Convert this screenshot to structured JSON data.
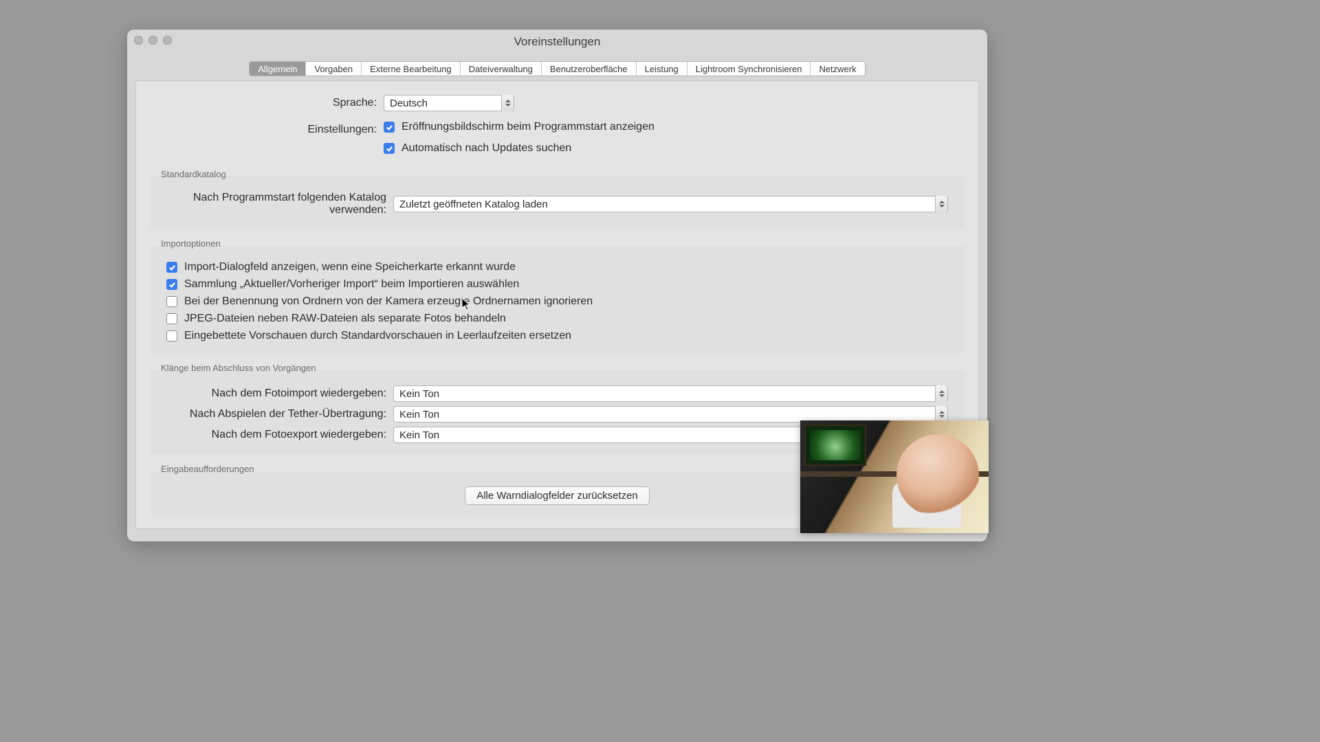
{
  "window": {
    "title": "Voreinstellungen"
  },
  "tabs": [
    {
      "id": "allgemein",
      "label": "Allgemein",
      "active": true
    },
    {
      "id": "vorgaben",
      "label": "Vorgaben"
    },
    {
      "id": "extern",
      "label": "Externe Bearbeitung"
    },
    {
      "id": "datei",
      "label": "Dateiverwaltung"
    },
    {
      "id": "ui",
      "label": "Benutzeroberfläche"
    },
    {
      "id": "leistung",
      "label": "Leistung"
    },
    {
      "id": "sync",
      "label": "Lightroom Synchronisieren"
    },
    {
      "id": "netz",
      "label": "Netzwerk"
    }
  ],
  "language": {
    "label": "Sprache:",
    "value": "Deutsch"
  },
  "settings": {
    "label": "Einstellungen:",
    "opt1": "Eröffnungsbildschirm beim Programmstart anzeigen",
    "opt2": "Automatisch nach Updates suchen"
  },
  "catalog": {
    "legend": "Standardkatalog",
    "label": "Nach Programmstart folgenden Katalog verwenden:",
    "value": "Zuletzt geöffneten Katalog laden"
  },
  "import": {
    "legend": "Importoptionen",
    "o1": "Import-Dialogfeld anzeigen, wenn eine Speicherkarte erkannt wurde",
    "o2": "Sammlung „Aktueller/Vorheriger Import“ beim Importieren auswählen",
    "o3": "Bei der Benennung von Ordnern von der Kamera erzeugte Ordnernamen ignorieren",
    "o4": "JPEG-Dateien neben RAW-Dateien als separate Fotos behandeln",
    "o5": "Eingebettete Vorschauen durch Standardvorschauen in Leerlaufzeiten ersetzen"
  },
  "sounds": {
    "legend": "Klänge beim Abschluss von Vorgängen",
    "r1": {
      "label": "Nach dem Fotoimport wiedergeben:",
      "value": "Kein Ton"
    },
    "r2": {
      "label": "Nach Abspielen der Tether-Übertragung:",
      "value": "Kein Ton"
    },
    "r3": {
      "label": "Nach dem Fotoexport wiedergeben:",
      "value": "Kein Ton"
    }
  },
  "prompts": {
    "legend": "Eingabeaufforderungen",
    "button": "Alle Warndialogfelder zurücksetzen"
  }
}
